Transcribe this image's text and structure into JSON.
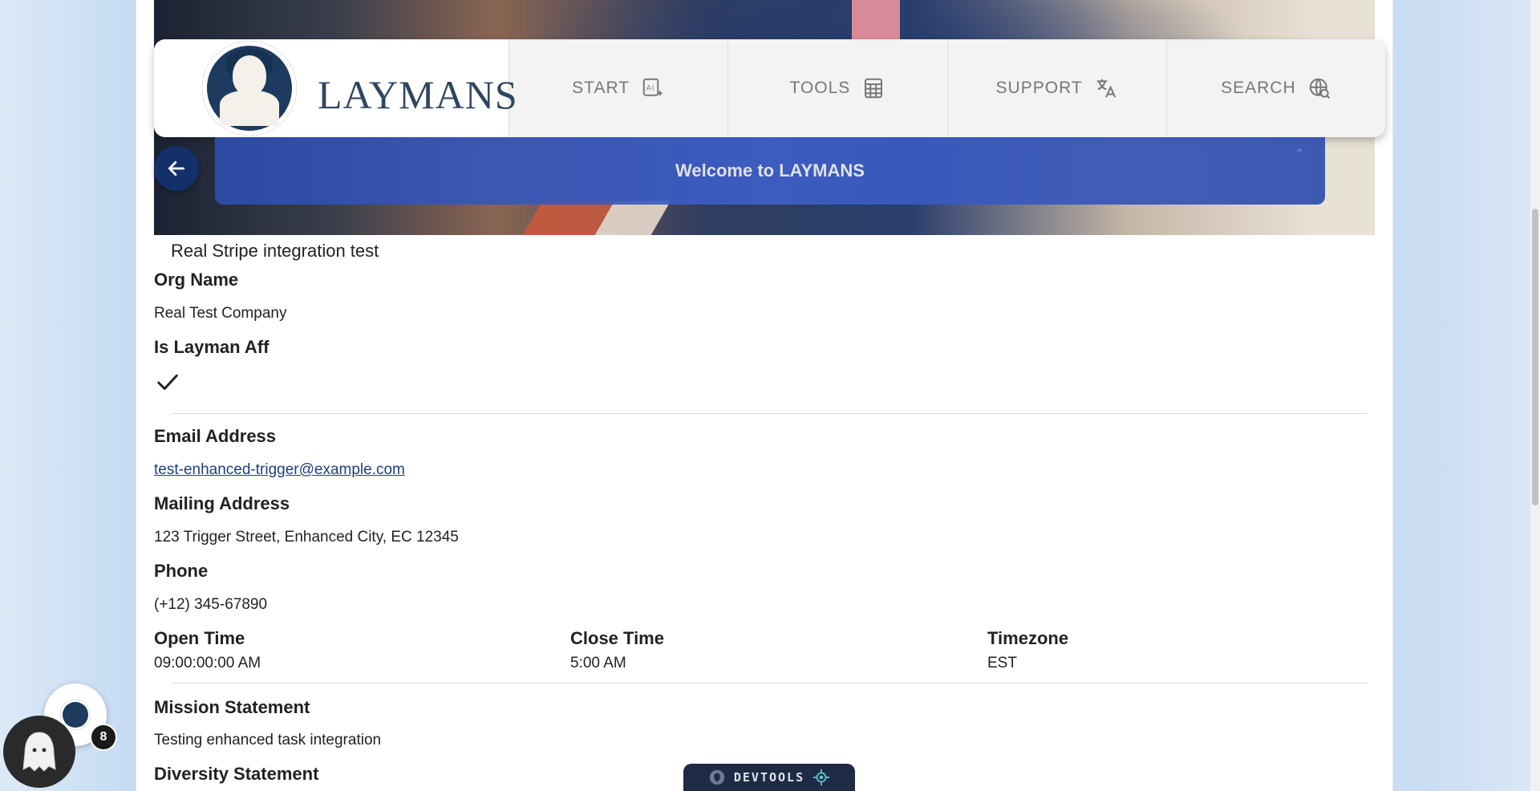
{
  "brand": {
    "name": "LAYMANS"
  },
  "nav": {
    "items": [
      {
        "label": "START",
        "icon": "ai-sparkle-icon"
      },
      {
        "label": "TOOLS",
        "icon": "calculator-icon"
      },
      {
        "label": "SUPPORT",
        "icon": "translate-icon"
      },
      {
        "label": "SEARCH",
        "icon": "search-globe-icon"
      }
    ]
  },
  "banner": {
    "title": "Welcome to LAYMANS"
  },
  "profile": {
    "subtitle": "Real Stripe integration test",
    "org_name_label": "Org Name",
    "org_name": "Real Test Company",
    "is_layman_aff_label": "Is Layman Aff",
    "is_layman_aff": true,
    "email_label": "Email Address",
    "email": "test-enhanced-trigger@example.com",
    "mailing_label": "Mailing Address",
    "mailing": "123 Trigger Street, Enhanced City, EC 12345",
    "phone_label": "Phone",
    "phone": "(+12) 345-67890",
    "open_time_label": "Open Time",
    "open_time": "09:00:00:00 AM",
    "close_time_label": "Close Time",
    "close_time": "5:00 AM",
    "timezone_label": "Timezone",
    "timezone": "EST",
    "mission_label": "Mission Statement",
    "mission": "Testing enhanced task integration",
    "diversity_label": "Diversity Statement"
  },
  "widgets": {
    "notification_count": "8",
    "devtools_label": "DEVTOOLS"
  },
  "colors": {
    "brand_navy": "#1e3a5f",
    "banner_blue": "#3f5fc7",
    "link": "#1f3f7a"
  }
}
